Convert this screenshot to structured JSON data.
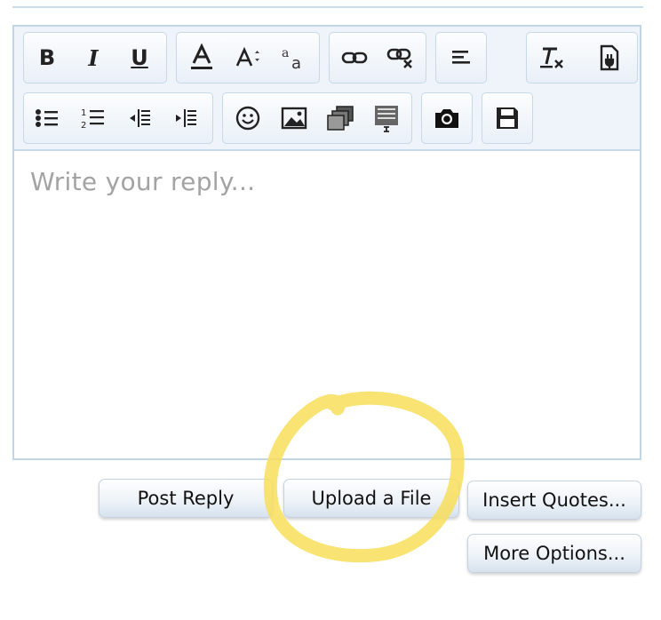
{
  "editor": {
    "placeholder": "Write your reply...",
    "toolbar": {
      "row1": [
        "bold-icon",
        "italic-icon",
        "underline-icon",
        "text-color-icon",
        "font-size-icon",
        "font-family-icon",
        "link-icon",
        "unlink-icon",
        "align-icon",
        "remove-format-icon",
        "bbcode-toggle-icon"
      ],
      "row2": [
        "bulleted-list-icon",
        "numbered-list-icon",
        "outdent-icon",
        "indent-icon",
        "smilies-icon",
        "image-icon",
        "media-icon",
        "insert-more-icon",
        "camera-icon",
        "save-draft-icon"
      ],
      "bold_glyph": "B",
      "italic_glyph": "I",
      "underline_glyph": "U"
    }
  },
  "actions": {
    "post_reply": "Post Reply",
    "upload_file": "Upload a File",
    "insert_quotes": "Insert Quotes...",
    "more_options": "More Options..."
  },
  "colors": {
    "toolbar_bg": "#eef4fa",
    "border": "#c2d7e5",
    "highlight": "#f7de5a"
  }
}
